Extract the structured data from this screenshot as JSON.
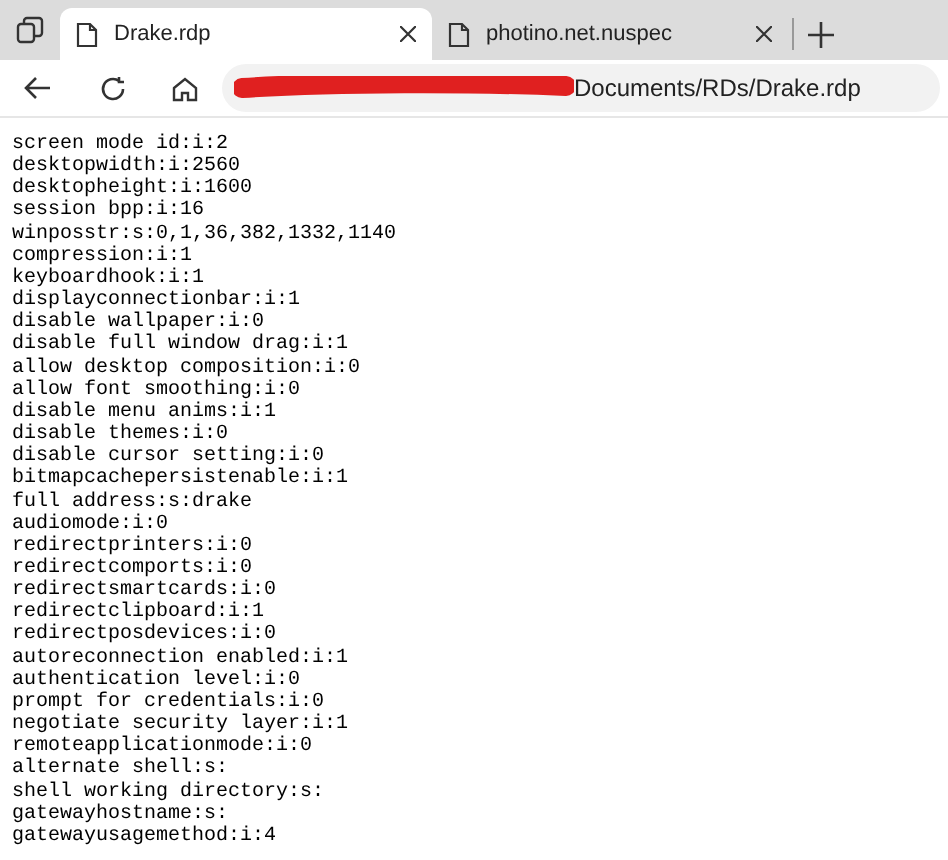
{
  "tabs": [
    {
      "title": "Drake.rdp",
      "selected": true
    },
    {
      "title": "photino.net.nuspec",
      "selected": false
    }
  ],
  "address_bar": {
    "value": "Documents/RDs/Drake.rdp",
    "redacted": true
  },
  "lines": [
    "screen mode id:i:2",
    "desktopwidth:i:2560",
    "desktopheight:i:1600",
    "session bpp:i:16",
    "winposstr:s:0,1,36,382,1332,1140",
    "compression:i:1",
    "keyboardhook:i:1",
    "displayconnectionbar:i:1",
    "disable wallpaper:i:0",
    "disable full window drag:i:1",
    "allow desktop composition:i:0",
    "allow font smoothing:i:0",
    "disable menu anims:i:1",
    "disable themes:i:0",
    "disable cursor setting:i:0",
    "bitmapcachepersistenable:i:1",
    "full address:s:drake",
    "audiomode:i:0",
    "redirectprinters:i:0",
    "redirectcomports:i:0",
    "redirectsmartcards:i:0",
    "redirectclipboard:i:1",
    "redirectposdevices:i:0",
    "autoreconnection enabled:i:1",
    "authentication level:i:0",
    "prompt for credentials:i:0",
    "negotiate security layer:i:1",
    "remoteapplicationmode:i:0",
    "alternate shell:s:",
    "shell working directory:s:",
    "gatewayhostname:s:",
    "gatewayusagemethod:i:4"
  ]
}
